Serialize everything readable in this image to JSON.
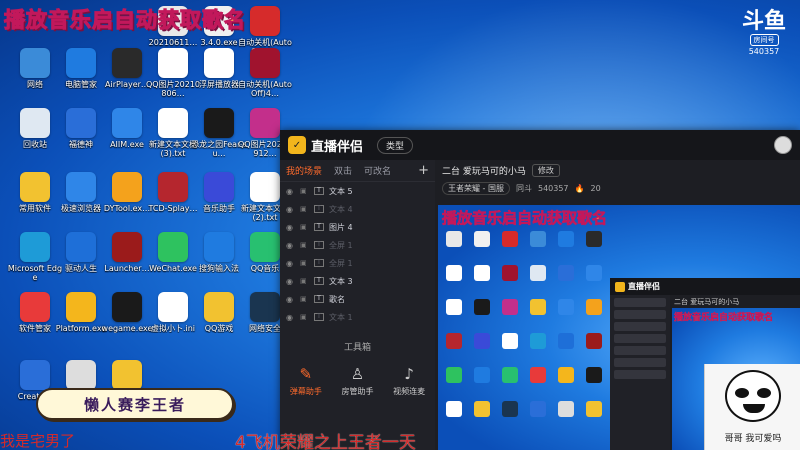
{
  "overlay": {
    "title": "播放音乐启自动获取歌名",
    "banner": "懒人赛李王者",
    "ticker_left": "我是宅男了",
    "ticker_right": "4飞机荣耀之上王者一天",
    "meme_caption": "哥哥 我可爱吗"
  },
  "douyu": {
    "glyph": "斗鱼",
    "room_tag": "房间号",
    "room_id": "540357"
  },
  "desktop_icons": [
    {
      "label": "20210611…",
      "color": "#e8e8e8"
    },
    {
      "label": "3.4.0.exe",
      "color": "#f0f0f0"
    },
    {
      "label": "自动关机(AutoOff)4…",
      "color": "#d62b2b"
    },
    {
      "label": "网络",
      "color": "#3b8bd8"
    },
    {
      "label": "电脑管家",
      "color": "#1f7be0"
    },
    {
      "label": "AirPlayer…",
      "color": "#2a2a2a"
    },
    {
      "label": "QQ图片20210806…",
      "color": "#ffffff"
    },
    {
      "label": "浮屏播放器",
      "color": "#ffffff"
    },
    {
      "label": "自动关机(AutoOff)4…",
      "color": "#a0132e"
    },
    {
      "label": "回收站",
      "color": "#dfe8f2"
    },
    {
      "label": "福德神",
      "color": "#2a6ed8"
    },
    {
      "label": "AIIM.exe",
      "color": "#2f86e8"
    },
    {
      "label": "新建文本文档(3).txt",
      "color": "#ffffff"
    },
    {
      "label": "恐龙之园Fear-su…",
      "color": "#1a1a1a"
    },
    {
      "label": "QQ图片20210912…",
      "color": "#c32f8b"
    },
    {
      "label": "常用软件",
      "color": "#f2c230"
    },
    {
      "label": "极速浏览器",
      "color": "#2f86e8"
    },
    {
      "label": "DYTool.ex…",
      "color": "#f4a21c"
    },
    {
      "label": "TCD-Splay…",
      "color": "#b5262e"
    },
    {
      "label": "音乐助手",
      "color": "#3a4ad8"
    },
    {
      "label": "新建文本文档(2).txt",
      "color": "#ffffff"
    },
    {
      "label": "Microsoft Edge",
      "color": "#1e9bd7"
    },
    {
      "label": "驱动人生",
      "color": "#1e6fd8"
    },
    {
      "label": "Launcher…",
      "color": "#9b1b1b"
    },
    {
      "label": "WeChat.exe",
      "color": "#2ec25f"
    },
    {
      "label": "搜狗输入法",
      "color": "#1f7be0"
    },
    {
      "label": "QQ音乐",
      "color": "#28c070"
    },
    {
      "label": "软件管家",
      "color": "#e83a3a"
    },
    {
      "label": "Platform.exe",
      "color": "#f4b61c"
    },
    {
      "label": "wegame.exe",
      "color": "#1a1a1a"
    },
    {
      "label": "虚拟小卜.ini",
      "color": "#ffffff"
    },
    {
      "label": "QQ游戏",
      "color": "#f2c230"
    },
    {
      "label": "网络安全",
      "color": "#1a3550"
    },
    {
      "label": "Create…",
      "color": "#2a6ed8"
    },
    {
      "label": "…",
      "color": "#dddddd"
    },
    {
      "label": "…",
      "color": "#f2c230"
    }
  ],
  "app": {
    "name": "直播伴侣",
    "type_button": "类型",
    "tabs": [
      "我的场景",
      "双击",
      "可改名"
    ],
    "add_label": "+",
    "sources": [
      {
        "label": "文本 5",
        "dim": false
      },
      {
        "label": "文本 4",
        "dim": true
      },
      {
        "label": "图片 4",
        "dim": false
      },
      {
        "label": "全屏 1",
        "dim": true
      },
      {
        "label": "全屏 1",
        "dim": true
      },
      {
        "label": "文本 3",
        "dim": false
      },
      {
        "label": "歌名",
        "dim": false
      },
      {
        "label": "文本 1",
        "dim": true
      }
    ],
    "toolbox_title": "工具箱",
    "tools": [
      {
        "label": "弹幕助手",
        "icon": "chat-icon",
        "active": true
      },
      {
        "label": "房管助手",
        "icon": "person-icon",
        "active": false
      },
      {
        "label": "视频连麦",
        "icon": "mic-icon",
        "active": false
      }
    ],
    "room_title": "二台 爱玩马可的小马",
    "edit_label": "修改",
    "category": "王者荣耀 - 国服",
    "meta_prefix": "同斗",
    "room_id": "540357",
    "viewers": "20",
    "nested_title": "直播伴侣",
    "nested_room": "二台 爱玩马可的小马"
  }
}
